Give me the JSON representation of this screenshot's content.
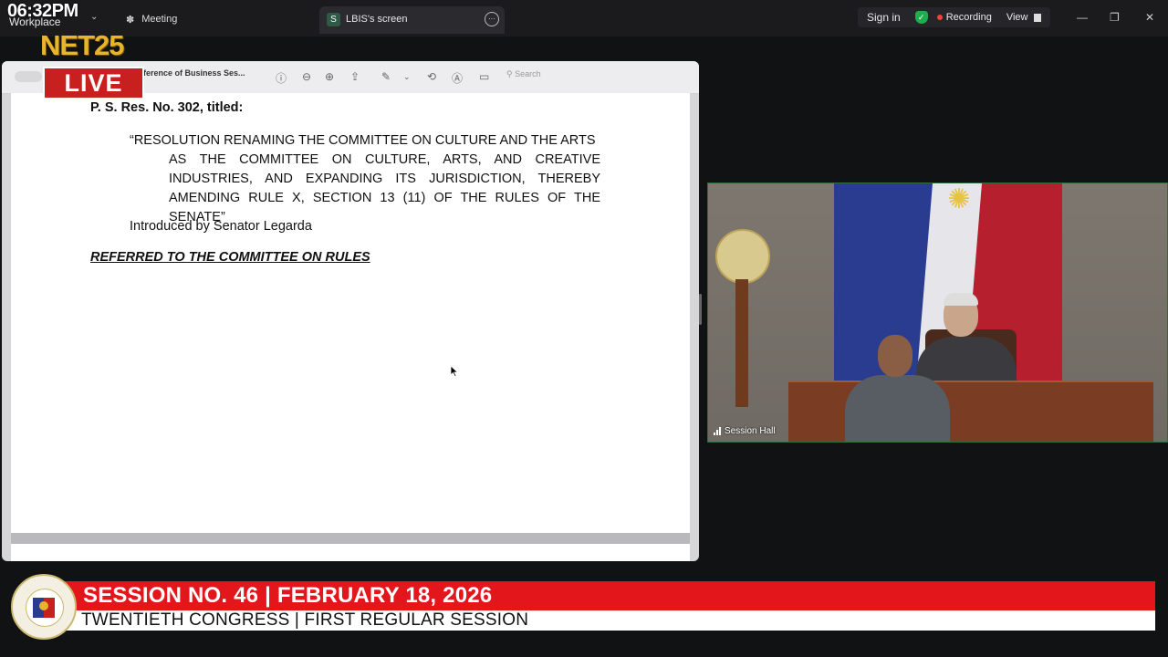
{
  "top_bar": {
    "app_name": "Workplace",
    "meeting_label": "Meeting",
    "tab_favicon": "S",
    "tab_title": "LBIS's screen",
    "sign_in": "Sign in",
    "recording": "Recording",
    "view": "View"
  },
  "overlay": {
    "clock": "06:32PM",
    "brand": "NET25",
    "live": "LIVE"
  },
  "document": {
    "window_title": "eference of Business Ses...",
    "search_placeholder": "Search",
    "res_number": "P. S. Res. No. 302, titled:",
    "res_title_line1": "“RESOLUTION RENAMING THE COMMITTEE ON CULTURE AND THE ARTS",
    "res_title_line2": "AS THE COMMITTEE ON CULTURE, ARTS, AND CREATIVE",
    "res_title_line3": "INDUSTRIES, AND EXPANDING ITS JURISDICTION, THEREBY",
    "res_title_line4": "AMENDING RULE X, SECTION 13 (11) OF THE RULES OF THE SENATE”",
    "introduced_by": "Introduced by Senator Legarda",
    "referral": "REFERRED TO THE COMMITTEE ON RULES"
  },
  "video": {
    "label": "Session Hall"
  },
  "lower_third": {
    "session": "SESSION NO. 46 | FEBRUARY 18, 2026",
    "congress": "TWENTIETH CONGRESS | FIRST REGULAR SESSION"
  },
  "colors": {
    "lower_third_red": "#e3161b",
    "live_red": "#c8201f",
    "brand_gold": "#e8b42a"
  }
}
